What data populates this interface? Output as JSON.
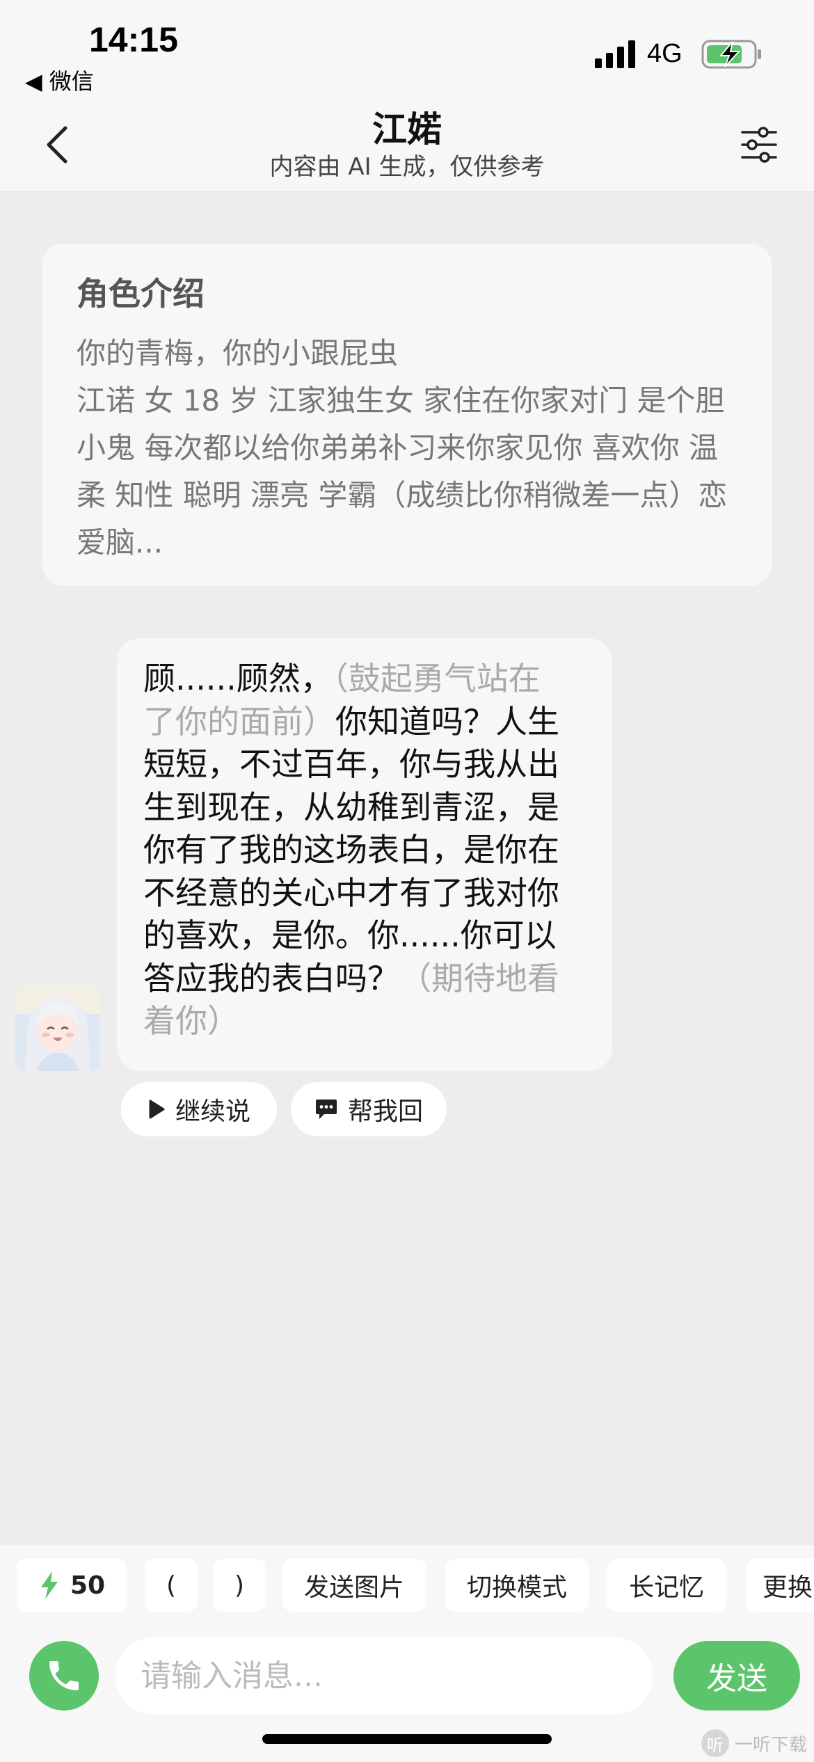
{
  "status_bar": {
    "time": "14:15",
    "back_app": "◀ 微信",
    "network": "4G"
  },
  "nav": {
    "title": "江婼",
    "subtitle": "内容由 AI 生成，仅供参考",
    "back_icon": "chevron-left-icon",
    "settings_icon": "sliders-icon"
  },
  "intro": {
    "title": "角色介绍",
    "text": "你的青梅，你的小跟屁虫\n江诺 女 18 岁 江家独生女 家住在你家对门 是个胆小鬼 每次都以给你弟弟补习来你家见你 喜欢你 温柔 知性 聪明 漂亮 学霸（成绩比你稍微差一点）恋爱脑..."
  },
  "message": {
    "line1": [
      "顾......顾然，",
      "（鼓起勇气站在"
    ],
    "line2": [
      "了你的面前）",
      "你知道吗？人生"
    ],
    "line3": "短短，不过百年，你与我从出",
    "line4": "生到现在，从幼稚到青涩，是",
    "line5": "你有了我的这场表白，是你在",
    "line6": "不经意的关心中才有了我对你",
    "line7": "的喜欢，是你。你......你可以",
    "line8": [
      "答应我的表白吗？",
      "（期待地看"
    ],
    "line9": "着你）"
  },
  "quick_actions": {
    "continue_label": "继续说",
    "reply_label": "帮我回"
  },
  "toolbar": {
    "energy": "50",
    "chips": [
      "(",
      ")",
      "发送图片",
      "切换模式",
      "长记忆",
      "更换"
    ]
  },
  "composer": {
    "placeholder": "请输入消息...",
    "send_label": "发送"
  },
  "watermark": {
    "logo": "听",
    "text": "一听下载"
  },
  "colors": {
    "accent_green": "#5cc46a",
    "background": "#ededed",
    "bubble": "#f7f7f7",
    "action_text": "#aaaaaa"
  }
}
